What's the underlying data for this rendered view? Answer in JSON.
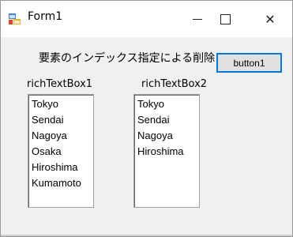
{
  "window": {
    "title": "Form1",
    "controls": {
      "minimize": "—",
      "maximize": "☐",
      "close": "✕"
    }
  },
  "heading": "要素のインデックス指定による削除",
  "button": {
    "label": "button1"
  },
  "richTextBox1": {
    "label": "richTextBox1",
    "lines": [
      "Tokyo",
      "Sendai",
      "Nagoya",
      "Osaka",
      "Hiroshima",
      "Kumamoto"
    ]
  },
  "richTextBox2": {
    "label": "richTextBox2",
    "lines": [
      "Tokyo",
      "Sendai",
      "Nagoya",
      "Hiroshima"
    ]
  },
  "icons": {
    "app": "winforms-app-icon"
  },
  "colors": {
    "accent": "#0078d7",
    "form_bg": "#f0f0f0"
  }
}
